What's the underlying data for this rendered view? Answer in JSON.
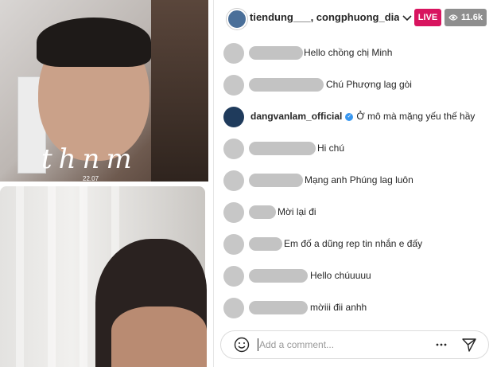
{
  "video": {
    "signature_text": "thnm",
    "date_text": "22.07"
  },
  "header": {
    "title": "tiendung___, congphuong_diam...",
    "live_label": "LIVE",
    "viewer_count": "11.6k"
  },
  "comments": [
    {
      "user": "",
      "text": "Hello chồng chị Minh",
      "blurred": true
    },
    {
      "user": "",
      "text": "Chú Phượng lag gòi",
      "blurred": true
    },
    {
      "user": "dangvanlam_official",
      "text": "Ở mô mà mặng yếu thế hầy",
      "blurred": false,
      "verified": true
    },
    {
      "user": "",
      "text": "Hi chú",
      "blurred": true
    },
    {
      "user": "",
      "text": "Mạng anh Phúng lag luôn",
      "blurred": true
    },
    {
      "user": "",
      "text": "Mời lại đi",
      "blurred": true
    },
    {
      "user": "",
      "text": "Em đố a dũng rep tin nhắn e đấy",
      "blurred": true
    },
    {
      "user": "",
      "text": "Hello chúuuuu",
      "blurred": true
    },
    {
      "user": "",
      "text": "mờiii đii anhh",
      "blurred": true
    }
  ],
  "input": {
    "placeholder": "Add a comment..."
  },
  "icons": {
    "chevron": "chevron-down-icon",
    "eye": "eye-icon",
    "smile": "smile-icon",
    "more": "more-icon",
    "send": "send-icon",
    "verified": "verified-badge-icon"
  },
  "colors": {
    "live": "#d8145f",
    "viewer_badge": "#8e8e8e",
    "verified": "#3897f0",
    "text": "#262626"
  }
}
